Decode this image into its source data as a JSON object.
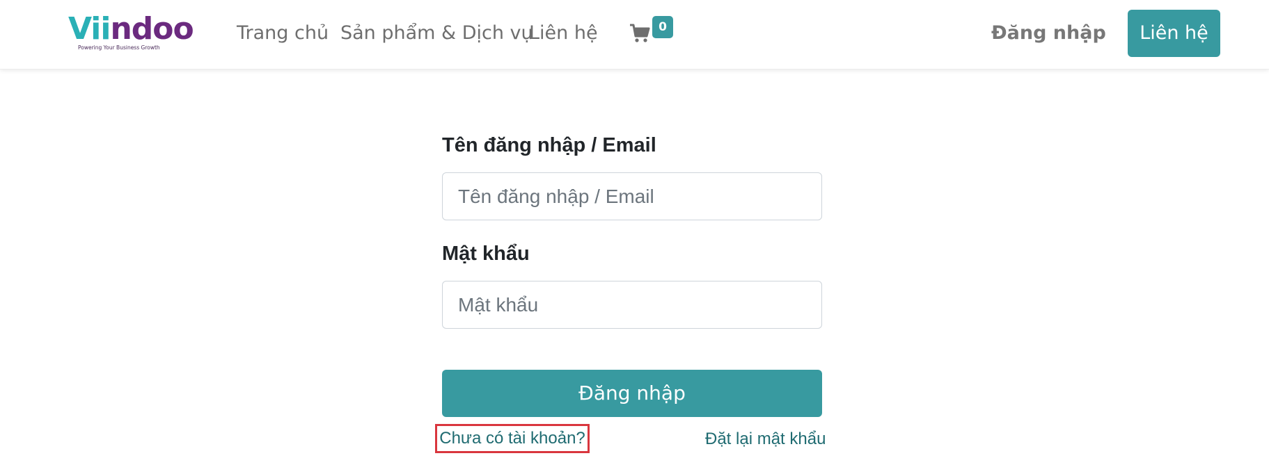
{
  "header": {
    "logo": {
      "text_part1": "Vii",
      "text_part2": "ndoo",
      "tagline": "Powering Your Business Growth"
    },
    "nav": [
      {
        "label": "Trang chủ"
      },
      {
        "label": "Sản phẩm & Dịch vụ"
      },
      {
        "label": "Liên hệ"
      }
    ],
    "cart": {
      "icon": "shopping-cart-icon",
      "count": "0"
    },
    "login_link": "Đăng nhập",
    "contact_button": "Liên hệ"
  },
  "form": {
    "username_label": "Tên đăng nhập / Email",
    "username_placeholder": "Tên đăng nhập / Email",
    "username_value": "",
    "password_label": "Mật khẩu",
    "password_placeholder": "Mật khẩu",
    "password_value": "",
    "submit_label": "Đăng nhập",
    "signup_link": "Chưa có tài khoản?",
    "reset_link": "Đặt lại mật khẩu"
  },
  "colors": {
    "accent": "#389aa0",
    "link": "#1f6b71",
    "highlight_box": "#d9363e",
    "logo_teal": "#2ab0b6",
    "logo_purple": "#6b2a7f"
  }
}
